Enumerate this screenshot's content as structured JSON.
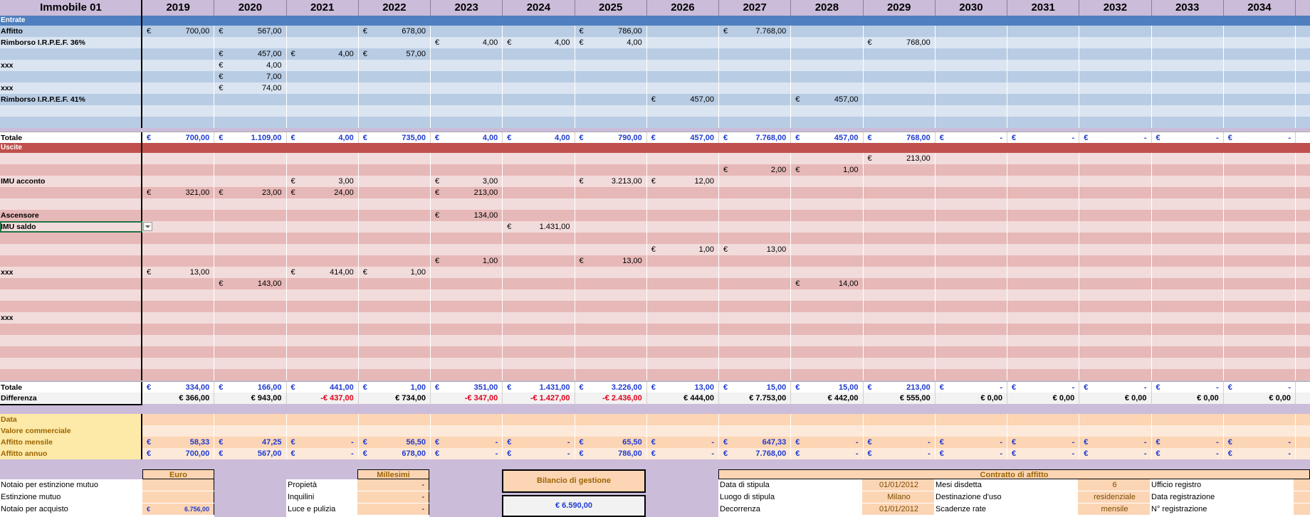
{
  "sheet_title": "Immobile 01",
  "years": [
    "2019",
    "2020",
    "2021",
    "2022",
    "2023",
    "2024",
    "2025",
    "2026",
    "2027",
    "2028",
    "2029",
    "2030",
    "2031",
    "2032",
    "2033",
    "2034"
  ],
  "currency_symbol": "€",
  "dash": "-",
  "sections": {
    "entrate": "Entrate",
    "uscite": "Uscite"
  },
  "entrate_rows": [
    {
      "label": "Affitto",
      "values": [
        "700,00",
        "567,00",
        "",
        "678,00",
        "",
        "",
        "786,00",
        "",
        "7.768,00",
        "",
        "",
        "",
        "",
        "",
        "",
        ""
      ]
    },
    {
      "label": "Rimborso I.R.P.E.F. 36%",
      "values": [
        "",
        "",
        "",
        "",
        "4,00",
        "4,00",
        "4,00",
        "",
        "",
        "",
        "768,00",
        "",
        "",
        "",
        "",
        ""
      ]
    },
    {
      "label": "",
      "values": [
        "",
        "457,00",
        "4,00",
        "57,00",
        "",
        "",
        "",
        "",
        "",
        "",
        "",
        "",
        "",
        "",
        "",
        ""
      ]
    },
    {
      "label": "xxx",
      "values": [
        "",
        "4,00",
        "",
        "",
        "",
        "",
        "",
        "",
        "",
        "",
        "",
        "",
        "",
        "",
        "",
        ""
      ]
    },
    {
      "label": "",
      "values": [
        "",
        "7,00",
        "",
        "",
        "",
        "",
        "",
        "",
        "",
        "",
        "",
        "",
        "",
        "",
        "",
        ""
      ]
    },
    {
      "label": "xxx",
      "values": [
        "",
        "74,00",
        "",
        "",
        "",
        "",
        "",
        "",
        "",
        "",
        "",
        "",
        "",
        "",
        "",
        ""
      ]
    },
    {
      "label": "Rimborso I.R.P.E.F. 41%",
      "values": [
        "",
        "",
        "",
        "",
        "",
        "",
        "",
        "457,00",
        "",
        "457,00",
        "",
        "",
        "",
        "",
        "",
        ""
      ]
    },
    {
      "label": "",
      "values": [
        "",
        "",
        "",
        "",
        "",
        "",
        "",
        "",
        "",
        "",
        "",
        "",
        "",
        "",
        "",
        ""
      ]
    },
    {
      "label": "",
      "values": [
        "",
        "",
        "",
        "",
        "",
        "",
        "",
        "",
        "",
        "",
        "",
        "",
        "",
        "",
        "",
        ""
      ]
    }
  ],
  "entrate_total": {
    "label": "Totale",
    "values": [
      "700,00",
      "1.109,00",
      "4,00",
      "735,00",
      "4,00",
      "4,00",
      "790,00",
      "457,00",
      "7.768,00",
      "457,00",
      "768,00",
      "-",
      "-",
      "-",
      "-",
      "-"
    ]
  },
  "uscite_rows": [
    {
      "label": "",
      "values": [
        "",
        "",
        "",
        "",
        "",
        "",
        "",
        "",
        "",
        "",
        "213,00",
        "",
        "",
        "",
        "",
        ""
      ]
    },
    {
      "label": "",
      "values": [
        "",
        "",
        "",
        "",
        "",
        "",
        "",
        "",
        "2,00",
        "1,00",
        "",
        "",
        "",
        "",
        "",
        ""
      ]
    },
    {
      "label": "IMU acconto",
      "values": [
        "",
        "",
        "3,00",
        "",
        "3,00",
        "",
        "3.213,00",
        "12,00",
        "",
        "",
        "",
        "",
        "",
        "",
        "",
        ""
      ]
    },
    {
      "label": "",
      "values": [
        "321,00",
        "23,00",
        "24,00",
        "",
        "213,00",
        "",
        "",
        "",
        "",
        "",
        "",
        "",
        "",
        "",
        "",
        ""
      ]
    },
    {
      "label": "",
      "values": [
        "",
        "",
        "",
        "",
        "",
        "",
        "",
        "",
        "",
        "",
        "",
        "",
        "",
        "",
        "",
        ""
      ]
    },
    {
      "label": "Ascensore",
      "values": [
        "",
        "",
        "",
        "",
        "134,00",
        "",
        "",
        "",
        "",
        "",
        "",
        "",
        "",
        "",
        "",
        ""
      ]
    },
    {
      "label": "IMU saldo",
      "values": [
        "",
        "",
        "",
        "",
        "",
        "1.431,00",
        "",
        "",
        "",
        "",
        "",
        "",
        "",
        "",
        "",
        ""
      ]
    },
    {
      "label": "",
      "values": [
        "",
        "",
        "",
        "",
        "",
        "",
        "",
        "",
        "",
        "",
        "",
        "",
        "",
        "",
        "",
        ""
      ]
    },
    {
      "label": "",
      "values": [
        "",
        "",
        "",
        "",
        "",
        "",
        "",
        "1,00",
        "13,00",
        "",
        "",
        "",
        "",
        "",
        "",
        ""
      ]
    },
    {
      "label": "",
      "values": [
        "",
        "",
        "",
        "",
        "1,00",
        "",
        "13,00",
        "",
        "",
        "",
        "",
        "",
        "",
        "",
        "",
        ""
      ]
    },
    {
      "label": "xxx",
      "values": [
        "13,00",
        "",
        "414,00",
        "1,00",
        "",
        "",
        "",
        "",
        "",
        "",
        "",
        "",
        "",
        "",
        "",
        ""
      ]
    },
    {
      "label": "",
      "values": [
        "",
        "143,00",
        "",
        "",
        "",
        "",
        "",
        "",
        "",
        "14,00",
        "",
        "",
        "",
        "",
        "",
        ""
      ]
    },
    {
      "label": "",
      "values": [
        "",
        "",
        "",
        "",
        "",
        "",
        "",
        "",
        "",
        "",
        "",
        "",
        "",
        "",
        "",
        ""
      ]
    },
    {
      "label": "",
      "values": [
        "",
        "",
        "",
        "",
        "",
        "",
        "",
        "",
        "",
        "",
        "",
        "",
        "",
        "",
        "",
        ""
      ]
    },
    {
      "label": "xxx",
      "values": [
        "",
        "",
        "",
        "",
        "",
        "",
        "",
        "",
        "",
        "",
        "",
        "",
        "",
        "",
        "",
        ""
      ]
    },
    {
      "label": "",
      "values": [
        "",
        "",
        "",
        "",
        "",
        "",
        "",
        "",
        "",
        "",
        "",
        "",
        "",
        "",
        "",
        ""
      ]
    },
    {
      "label": "",
      "values": [
        "",
        "",
        "",
        "",
        "",
        "",
        "",
        "",
        "",
        "",
        "",
        "",
        "",
        "",
        "",
        ""
      ]
    },
    {
      "label": "",
      "values": [
        "",
        "",
        "",
        "",
        "",
        "",
        "",
        "",
        "",
        "",
        "",
        "",
        "",
        "",
        "",
        ""
      ]
    },
    {
      "label": "",
      "values": [
        "",
        "",
        "",
        "",
        "",
        "",
        "",
        "",
        "",
        "",
        "",
        "",
        "",
        "",
        "",
        ""
      ]
    },
    {
      "label": "",
      "values": [
        "",
        "",
        "",
        "",
        "",
        "",
        "",
        "",
        "",
        "",
        "",
        "",
        "",
        "",
        "",
        ""
      ]
    }
  ],
  "uscite_total": {
    "label": "Totale",
    "values": [
      "334,00",
      "166,00",
      "441,00",
      "1,00",
      "351,00",
      "1.431,00",
      "3.226,00",
      "13,00",
      "15,00",
      "15,00",
      "213,00",
      "-",
      "-",
      "-",
      "-",
      "-"
    ]
  },
  "differenza": {
    "label": "Differenza",
    "values": [
      "€ 366,00",
      "€ 943,00",
      "-€ 437,00",
      "€ 734,00",
      "-€ 347,00",
      "-€ 1.427,00",
      "-€ 2.436,00",
      "€ 444,00",
      "€ 7.753,00",
      "€ 442,00",
      "€ 555,00",
      "€ 0,00",
      "€ 0,00",
      "€ 0,00",
      "€ 0,00",
      "€ 0,00"
    ],
    "negative": [
      false,
      false,
      true,
      false,
      true,
      true,
      true,
      false,
      false,
      false,
      false,
      false,
      false,
      false,
      false,
      false
    ]
  },
  "info_rows": [
    {
      "label": "Data",
      "values": [
        "",
        "",
        "",
        "",
        "",
        "",
        "",
        "",
        "",
        "",
        "",
        "",
        "",
        "",
        "",
        ""
      ],
      "currency": false
    },
    {
      "label": "Valore commerciale",
      "values": [
        "",
        "",
        "",
        "",
        "",
        "",
        "",
        "",
        "",
        "",
        "",
        "",
        "",
        "",
        "",
        ""
      ],
      "currency": false
    },
    {
      "label": "Affitto mensile",
      "values": [
        "58,33",
        "47,25",
        "-",
        "56,50",
        "-",
        "-",
        "65,50",
        "-",
        "647,33",
        "-",
        "-",
        "-",
        "-",
        "-",
        "-",
        "-"
      ],
      "currency": true
    },
    {
      "label": "Affitto annuo",
      "values": [
        "700,00",
        "567,00",
        "-",
        "678,00",
        "-",
        "-",
        "786,00",
        "-",
        "7.768,00",
        "-",
        "-",
        "-",
        "-",
        "-",
        "-",
        "-"
      ],
      "currency": true
    }
  ],
  "costs_box": {
    "header": "Euro",
    "rows": [
      {
        "label": "Notaio per estinzione mutuo",
        "value": ""
      },
      {
        "label": "Estinzione mutuo",
        "value": ""
      },
      {
        "label": "Notaio per acquisto",
        "value": "6.756,00"
      }
    ]
  },
  "millesimi_box": {
    "header": "Millesimi",
    "rows": [
      {
        "label": "Propietà",
        "value": "-"
      },
      {
        "label": "Inquilini",
        "value": "-"
      },
      {
        "label": "Luce e pulizia",
        "value": "-"
      }
    ]
  },
  "bilancio": {
    "title": "Bilancio di gestione",
    "value": "€ 6.590,00"
  },
  "contratto": {
    "header": "Contratto di affitto",
    "rows": [
      {
        "label1": "Data di stipula",
        "value1": "01/01/2012",
        "label2": "Mesi disdetta",
        "value2": "6",
        "label3": "Ufficio registro"
      },
      {
        "label1": "Luogo di stipula",
        "value1": "Milano",
        "label2": "Destinazione d'uso",
        "value2": "residenziale",
        "label3": "Data registrazione"
      },
      {
        "label1": "Decorrenza",
        "value1": "01/01/2012",
        "label2": "Scadenze rate",
        "value2": "mensile",
        "label3": "N° registrazione"
      }
    ]
  },
  "colors": {
    "header_bg": "#cbbcda",
    "entrate_section": "#4f7fbe",
    "entrate_dark": "#b8cce4",
    "entrate_light": "#dbe5f1",
    "uscite_section": "#c0504d",
    "uscite_dark": "#e6b8b7",
    "uscite_light": "#f2dcdb",
    "total_bg": "#ffffff",
    "info_bg": "#fcd5b4",
    "info_label": "#9c6500"
  }
}
